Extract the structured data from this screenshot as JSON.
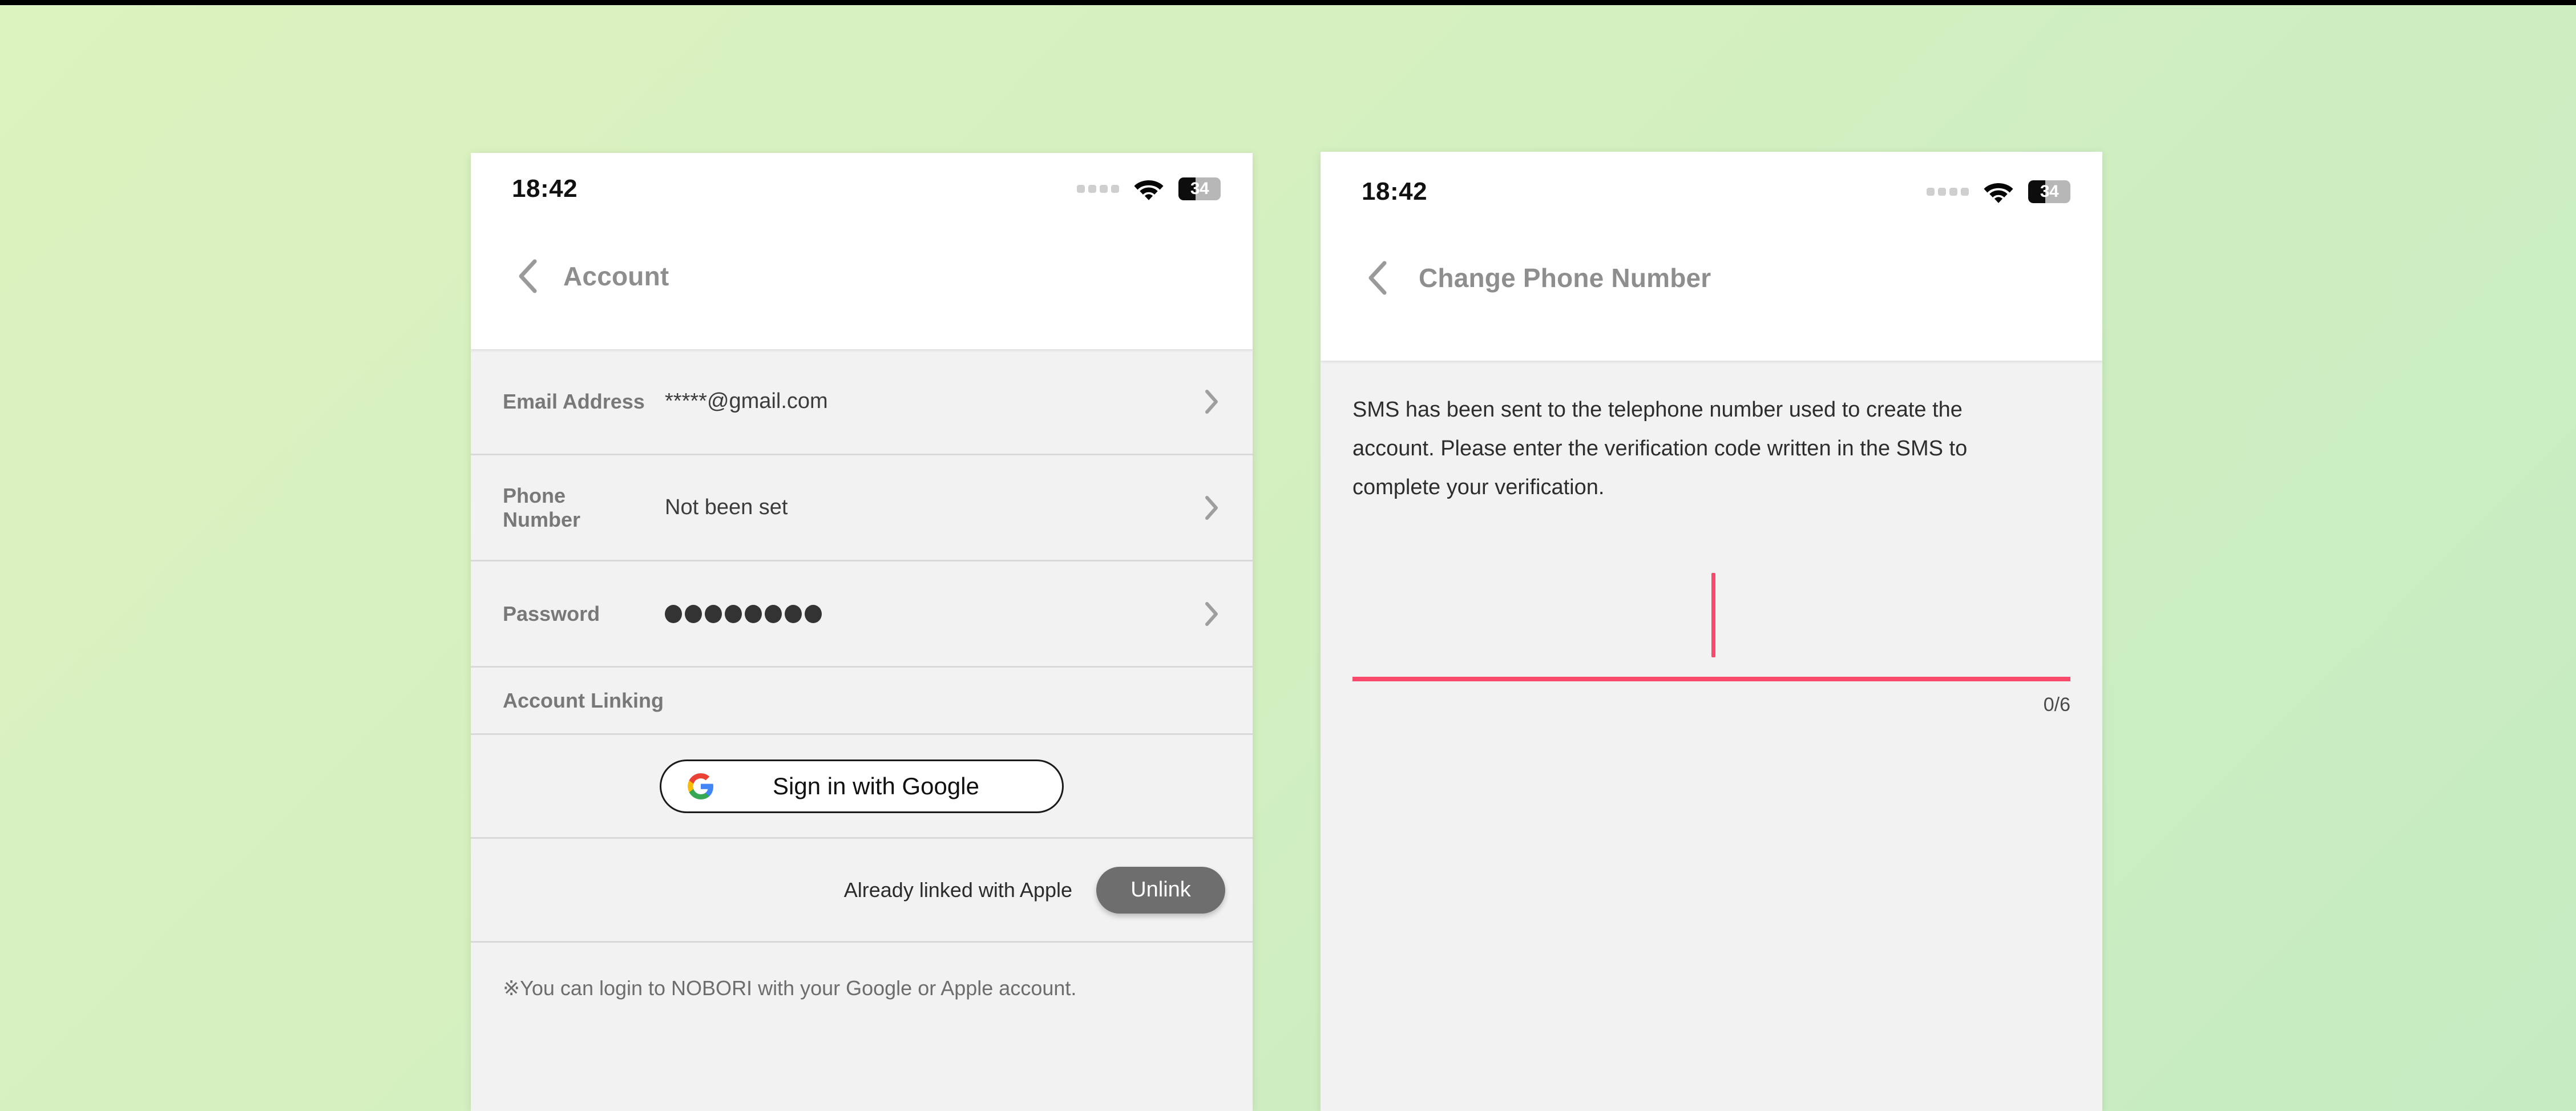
{
  "background": {
    "gradient_from": "#dcf3bf",
    "gradient_to": "#c6ebc3"
  },
  "status_bar": {
    "time": "18:42",
    "battery_percent": "34",
    "signal_icon": "signal-dots-icon",
    "wifi_icon": "wifi-icon",
    "battery_icon": "battery-icon"
  },
  "left_panel": {
    "nav": {
      "back_icon": "back-chevron-icon",
      "title": "Account"
    },
    "rows": [
      {
        "label": "Email Address",
        "value": "*****@gmail.com",
        "type": "text"
      },
      {
        "label": "Phone Number",
        "value": "Not been set",
        "type": "text"
      },
      {
        "label": "Password",
        "value": "●●●●●●●●",
        "type": "dots",
        "dot_count": 8
      }
    ],
    "section_header": "Account Linking",
    "google_button": {
      "label": "Sign in with Google",
      "icon": "google-logo-icon"
    },
    "apple_link": {
      "status_text": "Already linked with Apple",
      "button_label": "Unlink",
      "button_color": "#6e6e6e"
    },
    "footnote": "※You can login to NOBORI with your Google or Apple account."
  },
  "right_panel": {
    "nav": {
      "back_icon": "back-chevron-icon",
      "title": "Change Phone Number"
    },
    "description": "SMS has been sent to the telephone number used to create the account. Please enter the verification code written in the SMS to complete your verification.",
    "code_input": {
      "value": "",
      "counter": "0/6",
      "accent_color": "#f94a6b"
    }
  }
}
